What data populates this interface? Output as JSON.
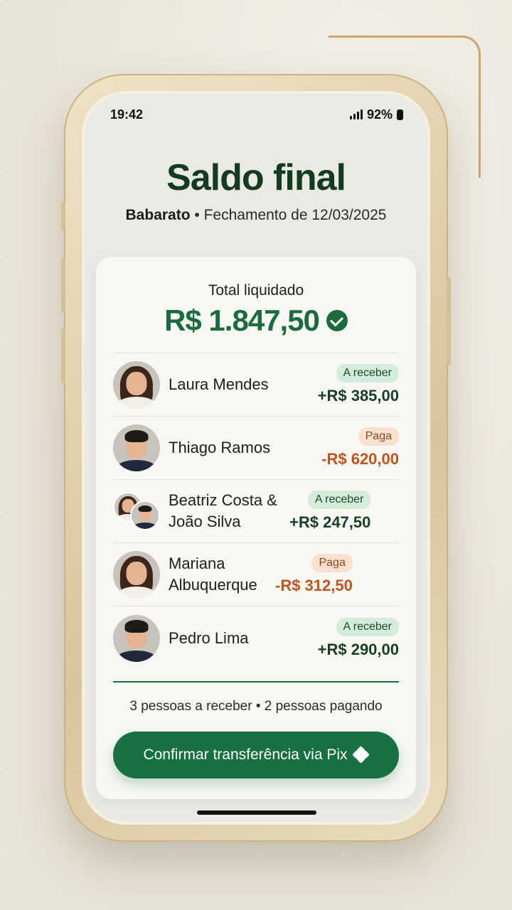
{
  "status": {
    "time": "19:42",
    "battery": "92%"
  },
  "header": {
    "title": "Saldo final",
    "group": "Babarato",
    "separator": "•",
    "closing": "Fechamento de 12/03/2025"
  },
  "total": {
    "label": "Total liquidado",
    "amount": "R$ 1.847,50"
  },
  "people": [
    {
      "name": "Laura Mendes",
      "status": "A receber",
      "amount": "+R$ 385,00",
      "type": "receive"
    },
    {
      "name": "Thiago Ramos",
      "status": "Paga",
      "amount": "-R$ 620,00",
      "type": "pay"
    },
    {
      "name": "Beatriz Costa & João Silva",
      "status": "A receber",
      "amount": "+R$ 247,50",
      "type": "receive"
    },
    {
      "name": "Mariana Albuquerque",
      "status": "Paga",
      "amount": "-R$ 312,50",
      "type": "pay"
    },
    {
      "name": "Pedro Lima",
      "status": "A receber",
      "amount": "+R$ 290,00",
      "type": "receive"
    }
  ],
  "summary": "3 pessoas a receber • 2 pessoas pagando",
  "cta": {
    "label": "Confirmar transferência via Pix"
  },
  "colors": {
    "brand_green": "#17703f",
    "pay_orange": "#c2541a",
    "receive_dark": "#173f24"
  }
}
